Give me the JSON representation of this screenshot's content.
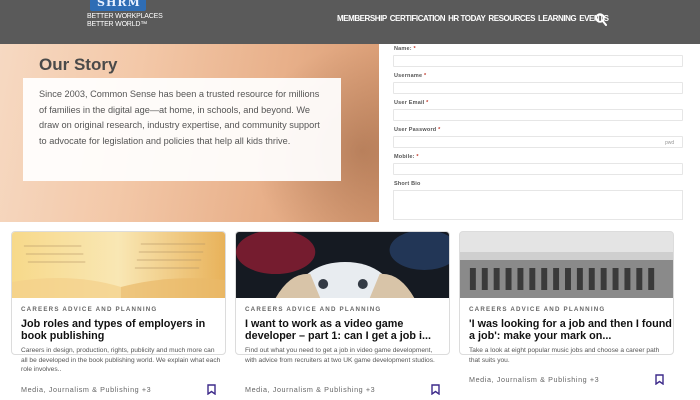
{
  "header": {
    "logo_letters": "SHRM",
    "tagline_line1": "BETTER WORKPLACES",
    "tagline_line2": "BETTER WORLD",
    "nav": [
      "MEMBERSHIP",
      "CERTIFICATION",
      "HR TODAY",
      "RESOURCES",
      "LEARNING",
      "EVENTS"
    ],
    "search_icon": "search-icon"
  },
  "hero": {
    "title": "Our Story",
    "text": "Since 2003, Common Sense has been a trusted resource for millions of families in the digital age—at home, in schools, and beyond. We draw on original research, industry expertise, and community support to advocate for legislation and policies that help all kids thrive."
  },
  "form": {
    "fields": [
      {
        "label": "Name:",
        "required": "*"
      },
      {
        "label": "Username",
        "required": "*"
      },
      {
        "label": "User Email",
        "required": "*"
      },
      {
        "label": "User Password",
        "required": "*"
      },
      {
        "label": "Mobile:",
        "required": "*"
      }
    ],
    "password_indicator": "pwd",
    "bio_label": "Short Bio"
  },
  "cards": [
    {
      "category": "CAREERS ADVICE AND PLANNING",
      "title": "Job roles and types of employers in book publishing",
      "description": "Careers in design, production, rights, publicity and much more can all be developed in the book publishing world. We explain what each role involves..",
      "tags": "Media, Journalism & Publishing +3"
    },
    {
      "category": "CAREERS ADVICE AND PLANNING",
      "title": "I want to work as a video game developer – part 1: can I get a job i...",
      "description": "Find out what you need to get a job in video game development, with advice from recruiters at two UK game development studios.",
      "tags": "Media, Journalism & Publishing +3"
    },
    {
      "category": "CAREERS ADVICE AND PLANNING",
      "title": "'I was looking for a job and then I found a job': make your mark on...",
      "description": "Take a look at eight popular music jobs and choose a career path that suits you.",
      "tags": "Media, Journalism & Publishing +3"
    }
  ],
  "colors": {
    "header_bg": "#5a5a5a",
    "bookmark": "#3d2a8a",
    "required": "#c0392b"
  }
}
